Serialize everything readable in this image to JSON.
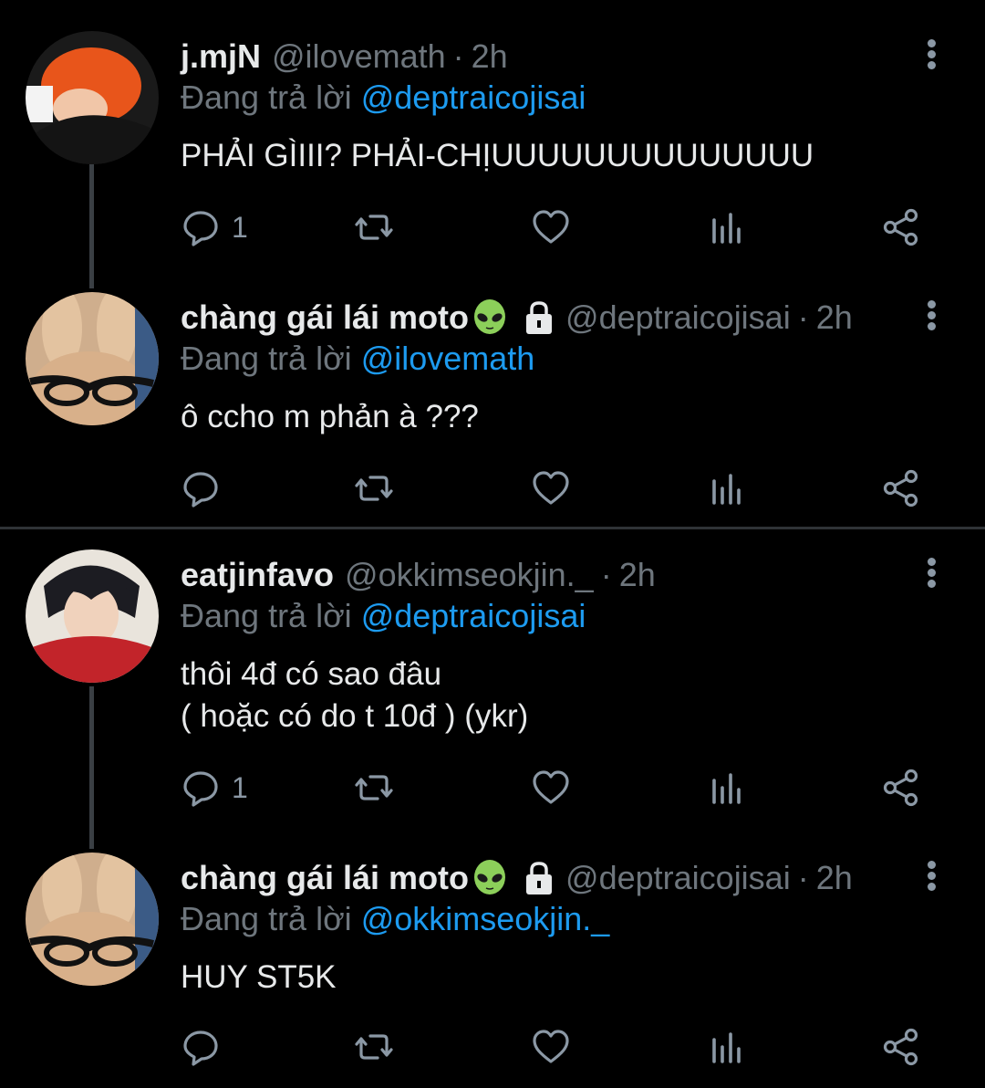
{
  "tweets": [
    {
      "name": "j.mjN",
      "handle": "@ilovemath",
      "time": "2h",
      "replying_label": "Đang trả lời",
      "replying_to": "@deptraicojisai",
      "text": "PHẢI GÌIII? PHẢI-CHỊUUUUUUUUUUUUUU",
      "reply_count": "1",
      "emoji": false,
      "locked": false
    },
    {
      "name": "chàng gái lái moto",
      "handle": "@deptraicojisai",
      "time": "2h",
      "replying_label": "Đang trả lời",
      "replying_to": "@ilovemath",
      "text": "ô ccho m phản à ???",
      "reply_count": "",
      "emoji": "alien-emoji",
      "locked": true
    },
    {
      "name": "eatjinfavo",
      "handle": "@okkimseokjin._",
      "time": "2h",
      "replying_label": "Đang trả lời",
      "replying_to": "@deptraicojisai",
      "text": "thôi 4đ có sao đâu\n( hoặc có do t 10đ ) (ykr)",
      "reply_count": "1",
      "emoji": false,
      "locked": false
    },
    {
      "name": "chàng gái lái moto",
      "handle": "@deptraicojisai",
      "time": "2h",
      "replying_label": "Đang trả lời",
      "replying_to": "@okkimseokjin._",
      "text": "HUY ST5K",
      "reply_count": "",
      "emoji": "alien-emoji",
      "locked": true
    }
  ],
  "separator": "·",
  "icons": [
    "reply-icon",
    "retweet-icon",
    "like-icon",
    "analytics-icon",
    "share-icon",
    "more-icon",
    "lock-icon"
  ],
  "colors": {
    "background": "#000000",
    "text": "#e7e9ea",
    "muted": "#6e767d",
    "link": "#1d9bf0",
    "icon": "#8b98a5"
  }
}
